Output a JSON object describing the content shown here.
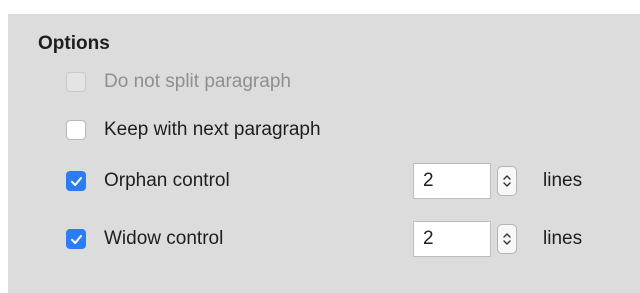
{
  "options": {
    "title": "Options",
    "do_not_split": {
      "label": "Do not split paragraph",
      "checked": false,
      "enabled": false
    },
    "keep_with_next": {
      "label": "Keep with next paragraph",
      "checked": false,
      "enabled": true
    },
    "orphan_control": {
      "label": "Orphan control",
      "checked": true,
      "lines_value": "2",
      "unit": "lines"
    },
    "widow_control": {
      "label": "Widow control",
      "checked": true,
      "lines_value": "2",
      "unit": "lines"
    }
  },
  "icons": {
    "check": "checkmark-icon",
    "spinner": "up-down-chevron-icon"
  },
  "colors": {
    "panel_background": "#dcdcdc",
    "checkbox_checked": "#2c7cf6",
    "text": "#1e1e1e",
    "text_disabled": "#8f8f8f"
  }
}
